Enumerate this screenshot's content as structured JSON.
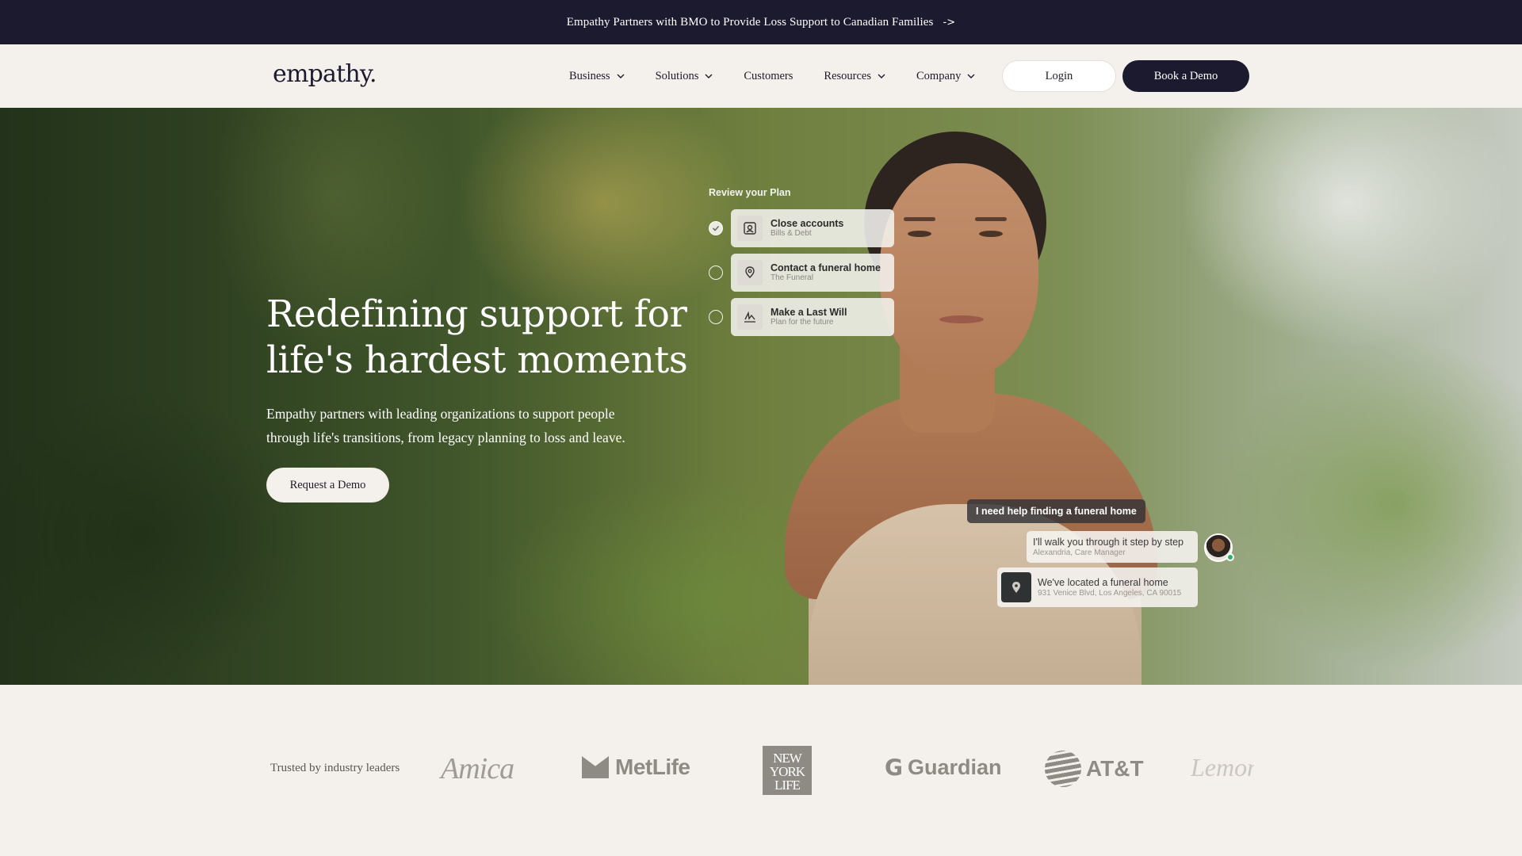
{
  "announcement": {
    "text": "Empathy Partners with BMO to Provide Loss Support to Canadian Families",
    "arrow": "->"
  },
  "header": {
    "logo": "empathy.",
    "nav": [
      {
        "label": "Business",
        "dropdown": true
      },
      {
        "label": "Solutions",
        "dropdown": true
      },
      {
        "label": "Customers",
        "dropdown": false
      },
      {
        "label": "Resources",
        "dropdown": true
      },
      {
        "label": "Company",
        "dropdown": true
      }
    ],
    "login_label": "Login",
    "demo_label": "Book a Demo"
  },
  "hero": {
    "title": "Redefining support for life's hardest moments",
    "subtitle": "Empathy partners with leading organizations to support people through life's transitions, from legacy planning to loss and leave.",
    "cta_label": "Request a Demo",
    "plan": {
      "title": "Review your Plan",
      "items": [
        {
          "title": "Close accounts",
          "subtitle": "Bills & Debt",
          "checked": true,
          "icon": "person-card-icon"
        },
        {
          "title": "Contact a funeral home",
          "subtitle": "The Funeral",
          "checked": false,
          "icon": "location-pin-icon"
        },
        {
          "title": "Make a Last Will",
          "subtitle": "Plan for the future",
          "checked": false,
          "icon": "signature-icon"
        }
      ]
    },
    "chat": {
      "user_message": "I need help finding a funeral home",
      "agent_message": "I'll walk you through it step by step",
      "agent_name": "Alexandria, Care Manager",
      "result_title": "We've located a funeral home",
      "result_address": "931 Venice Blvd, Los Angeles, CA 90015"
    }
  },
  "trusted": {
    "label": "Trusted by industry leaders",
    "logos": [
      "Amica",
      "MetLife",
      "NEW YORK LIFE",
      "Guardian",
      "AT&T",
      "Lemonade"
    ]
  },
  "colors": {
    "navy": "#1c1a2e",
    "cream": "#f4f0eb",
    "logo_gray": "#8e8a84",
    "online_green": "#28b463"
  }
}
